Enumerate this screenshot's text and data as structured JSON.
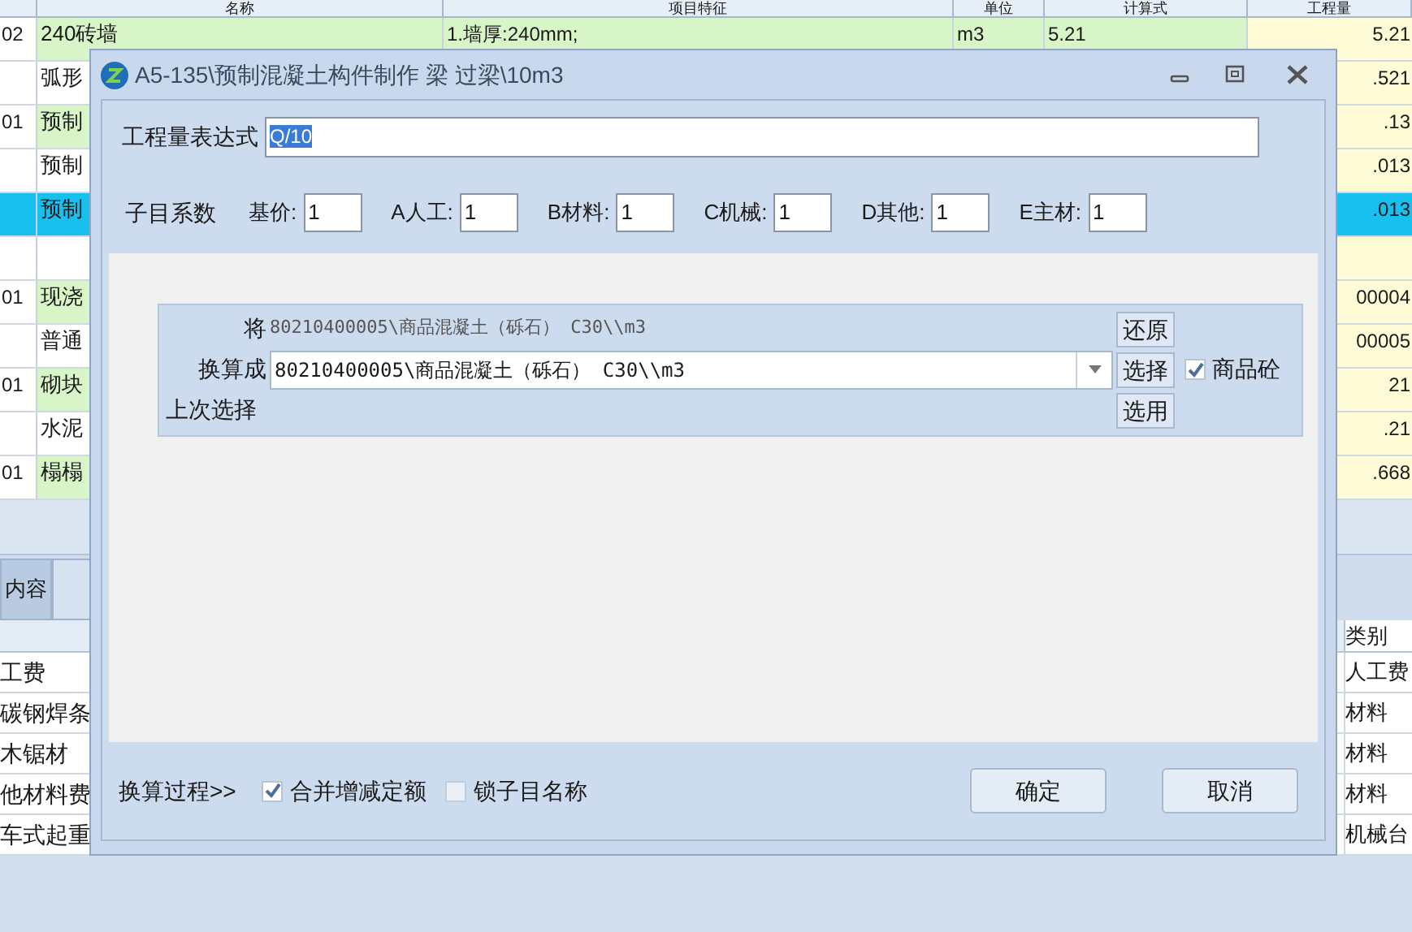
{
  "main_table": {
    "columns": [
      "名称",
      "项目特征",
      "单位",
      "计算式",
      "工程量"
    ],
    "rows": [
      {
        "code": "02",
        "name": "240砖墙",
        "feature": "1.墙厚:240mm;",
        "unit": "m3",
        "formula": "5.21",
        "quantity": "5.21",
        "kind": "item",
        "selected": false
      },
      {
        "name": "弧形",
        "quantity": ".521",
        "kind": "sub",
        "selected": false
      },
      {
        "code": "01",
        "name": "预制",
        "quantity": ".13",
        "kind": "item",
        "selected": false
      },
      {
        "name": "预制",
        "quantity": ".013",
        "kind": "sub",
        "selected": false
      },
      {
        "name": "预制",
        "quantity": ".013",
        "kind": "sub",
        "selected": true
      },
      {
        "kind": "sub",
        "selected": false
      },
      {
        "code": "01",
        "name": "现浇",
        "quantity": "00004",
        "kind": "item",
        "selected": false
      },
      {
        "name": "普通",
        "quantity": "00005",
        "kind": "sub",
        "selected": false
      },
      {
        "code": "01",
        "name": "砌块",
        "quantity": "21",
        "kind": "item",
        "selected": false
      },
      {
        "name": "水泥",
        "quantity": ".21",
        "kind": "sub",
        "selected": false
      },
      {
        "code": "01",
        "name": "榻榻",
        "quantity": ".668",
        "kind": "item",
        "selected": false
      }
    ]
  },
  "bottom_panel": {
    "tabs": [
      {
        "label": "内容",
        "selected": true
      }
    ],
    "category_header": "类别",
    "rows": [
      {
        "name": "工费",
        "category": "人工费"
      },
      {
        "name": "碳钢焊条",
        "category": "材料"
      },
      {
        "name": "木锯材",
        "category": "材料"
      },
      {
        "name": "他材料费",
        "category": "材料"
      },
      {
        "name": "车式起重",
        "category": "机械台"
      }
    ]
  },
  "dialog": {
    "title": "A5-135\\预制混凝土构件制作 梁 过梁\\10m3",
    "expression": {
      "label": "工程量表达式",
      "value": "Q/10"
    },
    "coefficients": {
      "label": "子目系数",
      "fields": [
        {
          "label": "基价:",
          "value": "1"
        },
        {
          "label": "A人工:",
          "value": "1"
        },
        {
          "label": "B材料:",
          "value": "1"
        },
        {
          "label": "C机械:",
          "value": "1"
        },
        {
          "label": "D其他:",
          "value": "1"
        },
        {
          "label": "E主材:",
          "value": "1"
        }
      ]
    },
    "replace": {
      "from_label": "将",
      "from_value": "80210400005\\商品混凝土（砾石） C30\\\\m3",
      "restore_button": "还原",
      "to_label": "换算成",
      "to_value": "80210400005\\商品混凝土（砾石） C30\\\\m3",
      "select_button": "选择",
      "commercial": {
        "label": "商品砼",
        "checked": true
      },
      "last_label": "上次选择",
      "use_button": "选用"
    },
    "footer": {
      "process_link": "换算过程>>",
      "options": [
        {
          "label": "合并增减定额",
          "checked": true
        },
        {
          "label": "锁子目名称",
          "checked": false
        }
      ],
      "buttons": [
        "确定",
        "取消"
      ]
    }
  }
}
